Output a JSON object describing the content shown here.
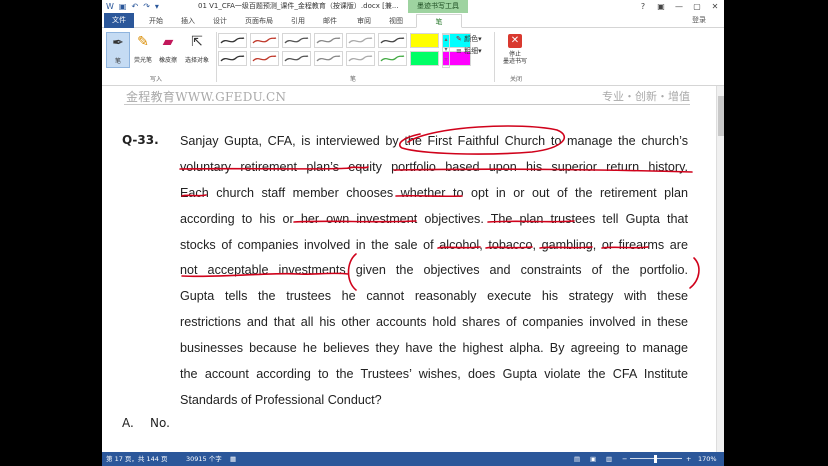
{
  "window": {
    "title": "01 V1_CFA一级百题预测_课件_金程教育（按课版）.docx [兼...",
    "context_tab": "墨迹书写工具",
    "controls": [
      "?",
      "▣",
      "—",
      "▢",
      "✕"
    ]
  },
  "qat": {
    "icons": [
      "word-icon",
      "save-icon",
      "undo-icon",
      "redo-icon",
      "customize-icon"
    ]
  },
  "tabs": [
    {
      "label": "文件"
    },
    {
      "label": "开始"
    },
    {
      "label": "插入"
    },
    {
      "label": "设计"
    },
    {
      "label": "页面布局"
    },
    {
      "label": "引用"
    },
    {
      "label": "邮件"
    },
    {
      "label": "审阅"
    },
    {
      "label": "视图"
    },
    {
      "label": "笔"
    }
  ],
  "login": "登录",
  "ribbon": {
    "tools": [
      {
        "label": "笔",
        "icon": "pen-icon"
      },
      {
        "label": "荧光笔",
        "icon": "highlighter-icon"
      },
      {
        "label": "橡皮擦",
        "icon": "eraser-icon"
      },
      {
        "label": "选择对象",
        "icon": "select-object-icon"
      }
    ],
    "group_write": "写入",
    "group_pens": "笔",
    "group_close": "关闭",
    "color_label": "颜色",
    "weight_label": "粗细",
    "stop_label_line1": "停止",
    "stop_label_line2": "墨迹书写",
    "pen_colors": [
      "#333333",
      "#c0392b",
      "#555555",
      "#888888",
      "#aaaaaa",
      "#444444",
      "#ffff00",
      "#00ffff",
      "#333333",
      "#c0392b",
      "#555555",
      "#888888",
      "#aaaaaa",
      "#44aa44",
      "#00ff66",
      "#ff00ff"
    ]
  },
  "document": {
    "header_left": "金程教育WWW.GFEDU.CN",
    "header_right": "专业・创新・增值",
    "question_number": "Q-33.",
    "lines": [
      "Sanjay Gupta, CFA, is interviewed by the First Faithful Church to manage the church’s",
      "voluntary retirement plan’s equity portfolio based upon his superior return history.",
      "Each church staff member chooses whether to opt in or out of the retirement plan",
      "according to his or her own investment objectives. The plan trustees tell Gupta that",
      "stocks of companies involved in the sale of alcohol, tobacco, gambling, or firearms are",
      "not acceptable investments given the objectives and constraints of the portfolio.",
      "Gupta tells the trustees he cannot reasonably execute his strategy with these",
      "restrictions and that all his other accounts hold shares of companies involved in these",
      "businesses because he believes they have the highest alpha. By agreeing to manage",
      "the account according to the Trustees’ wishes, does Gupta violate the CFA Institute",
      "Standards of Professional Conduct?"
    ],
    "answer_letter": "A.",
    "answer_text": "No.",
    "ink_color": "#d0021b"
  },
  "status": {
    "page": "第 17 页，共 144 页",
    "words": "30915 个字",
    "zoom": "170%"
  }
}
